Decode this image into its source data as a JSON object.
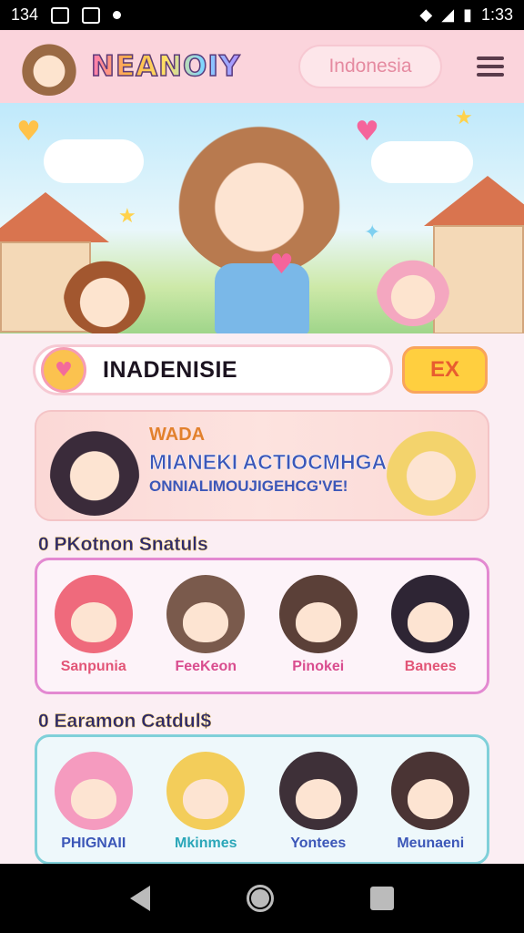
{
  "status_bar": {
    "time_left": "134",
    "time_right": "1:33"
  },
  "header": {
    "logo": "NEANOIY",
    "language": "Indonesia"
  },
  "search": {
    "value": "INADENISIE",
    "action_label": "EX"
  },
  "banner": {
    "kicker": "WADA",
    "line1": "MIANEKI ACTIOCMHGA",
    "line2": "ONNIALIMOUJIGEHCG'VE!"
  },
  "section1": {
    "title": "0 PKotnon Snatuls",
    "characters": [
      {
        "name": "Sanpunia",
        "color": "#e25577"
      },
      {
        "name": "FeeKeon",
        "color": "#d94d8f"
      },
      {
        "name": "Pinokei",
        "color": "#d94d8f"
      },
      {
        "name": "Banees",
        "color": "#e25577"
      }
    ]
  },
  "section2": {
    "title": "0 Earamon Catdul$",
    "characters": [
      {
        "name": "PHIGNAII",
        "color": "#3c57b8"
      },
      {
        "name": "Mkinmes",
        "color": "#2aa6b8"
      },
      {
        "name": "Yontees",
        "color": "#3c57b8"
      },
      {
        "name": "Meunaeni",
        "color": "#3c57b8"
      }
    ]
  }
}
